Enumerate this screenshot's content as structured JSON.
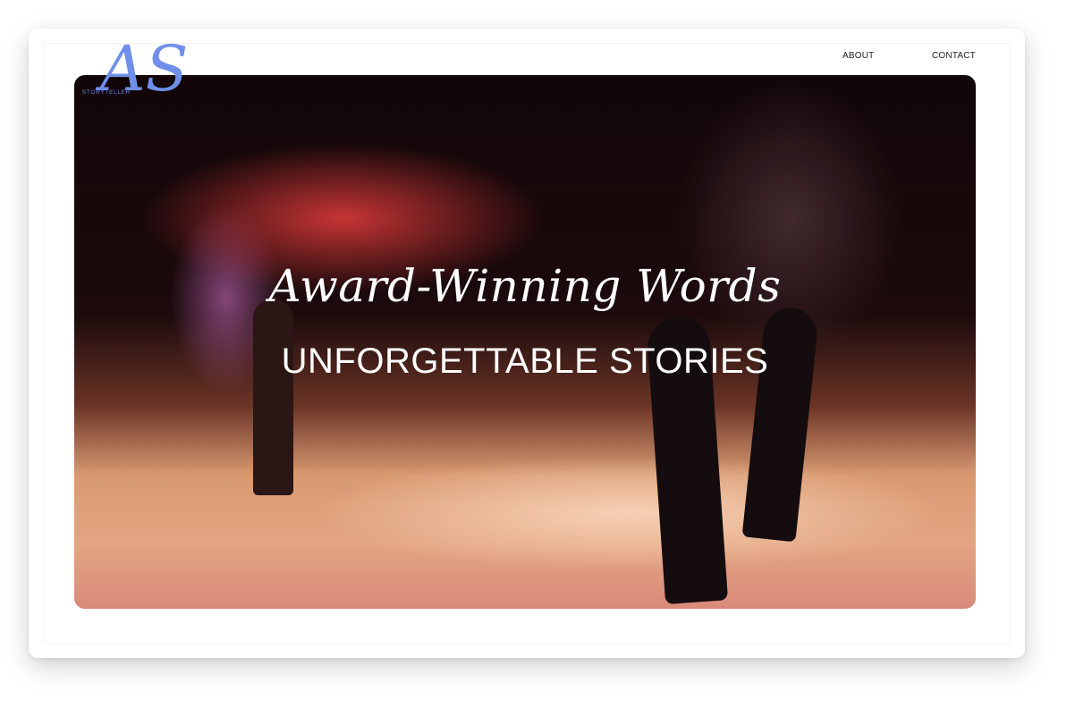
{
  "brand": {
    "monogram": "AS",
    "name": "STORYTELLER"
  },
  "nav": {
    "about": "ABOUT",
    "contact": "CONTACT"
  },
  "hero": {
    "title": "Award-Winning Words",
    "subtitle": "UNFORGETTABLE STORIES"
  }
}
